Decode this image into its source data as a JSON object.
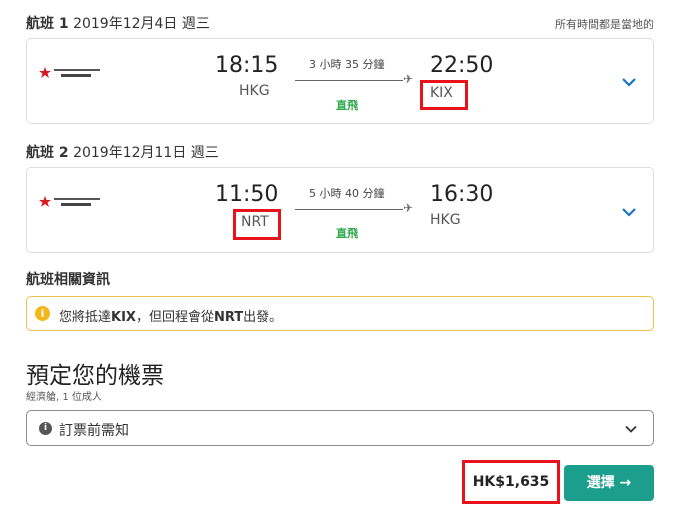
{
  "flight1": {
    "header_label": "航班 1",
    "header_date": " 2019年12月4日 週三",
    "depart_time": "18:15",
    "depart_airport": "HKG",
    "duration": "3 小時 35 分鐘",
    "arrive_time": "22:50",
    "arrive_airport": "KIX",
    "stops": "直飛"
  },
  "timezone_note": "所有時間都是當地的",
  "flight2": {
    "header_label": "航班 2",
    "header_date": " 2019年12月11日 週三",
    "depart_time": "11:50",
    "depart_airport": "NRT",
    "duration": "5 小時 40 分鐘",
    "arrive_time": "16:30",
    "arrive_airport": "HKG",
    "stops": "直飛"
  },
  "airline_logo_text": "HONGKONG AIRLINES 香港航空",
  "flight_info": {
    "title": "航班相關資訊",
    "notice_prefix": "您將抵達",
    "notice_arrive": "KIX",
    "notice_middle": "，但回程會從",
    "notice_depart": "NRT",
    "notice_suffix": "出發。"
  },
  "booking": {
    "title": "預定您的機票",
    "subtitle": "經濟艙, 1 位成人",
    "notes_label": "訂票前需知",
    "price": "HK$1,635",
    "select_label": "選擇 →"
  },
  "colors": {
    "highlight": "#e8121d",
    "accent_teal": "#1b9e8c",
    "direct_green": "#2aa84a",
    "chevron_blue": "#1a73c9",
    "warning_yellow": "#f5b61b"
  },
  "icons": {
    "expand": "chevron-down-icon",
    "plane": "plane-icon",
    "info": "info-icon"
  }
}
